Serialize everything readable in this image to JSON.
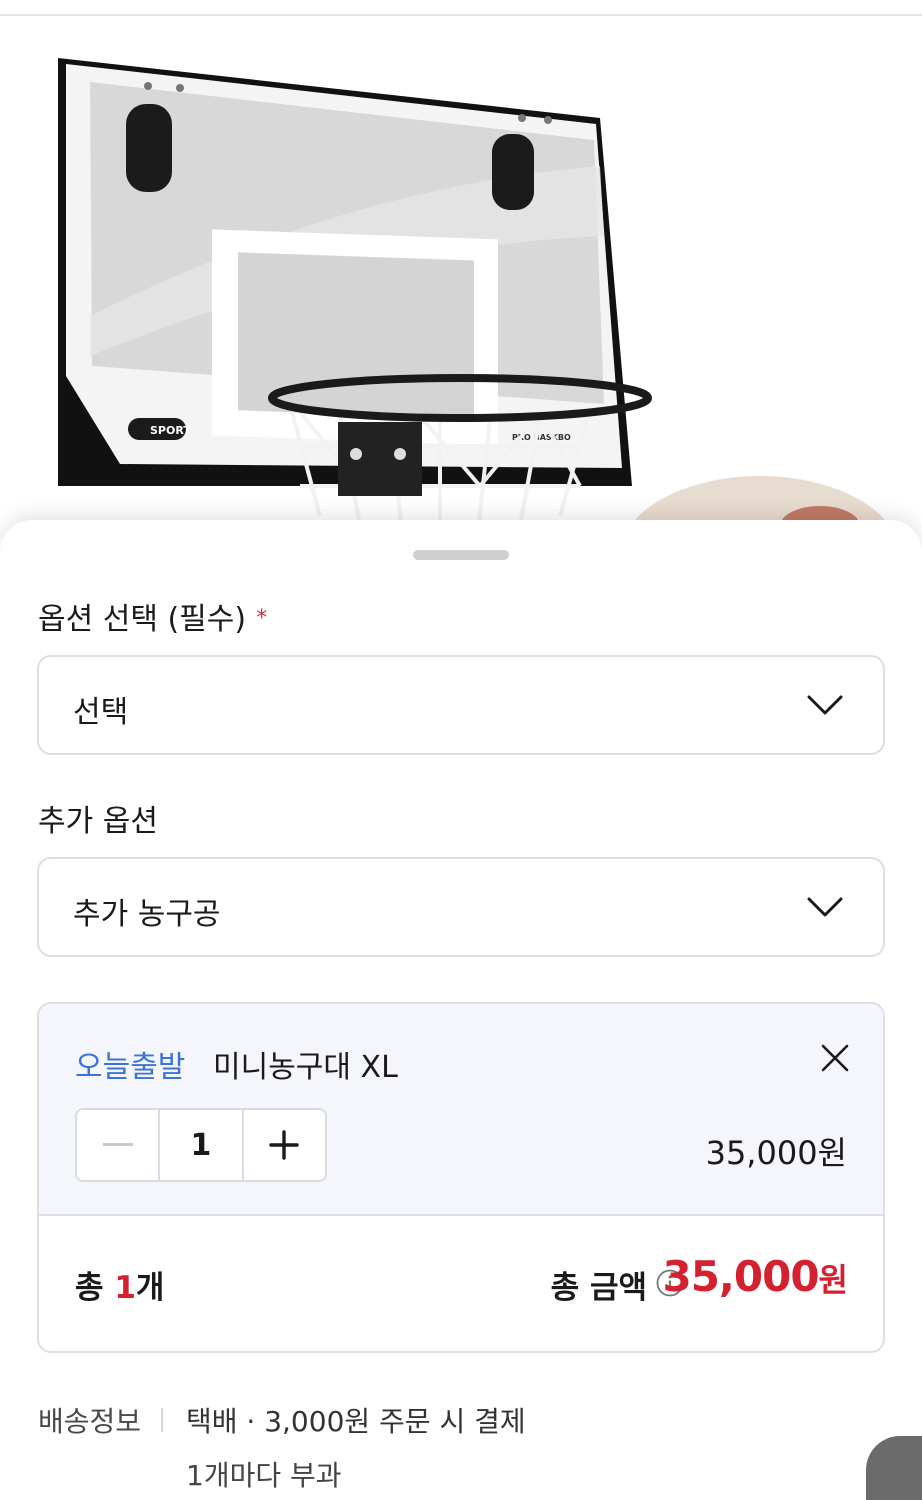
{
  "options": {
    "required_label": "옵션 선택 (필수)",
    "required_marker": "*",
    "required_select_value": "선택",
    "extra_label": "추가 옵션",
    "extra_select_value": "추가 농구공"
  },
  "order_item": {
    "badge": "오늘출발",
    "name": "미니농구대 XL",
    "quantity": "1",
    "price": "35,000원"
  },
  "totals": {
    "count_prefix": "총 ",
    "count_value": "1",
    "count_suffix": "개",
    "amount_label": "총 금액",
    "amount_value": "35,000",
    "amount_unit": "원"
  },
  "shipping": {
    "label": "배송정보",
    "value": "택배 · 3,000원 주문 시 결제",
    "note": "1개마다 부과"
  },
  "product_image": {
    "logo_text": "SPORT",
    "board_text": "PRO BASKBO"
  },
  "colors": {
    "accent_blue": "#3a74d8",
    "price_red": "#d4202f",
    "required_red": "#e0323a"
  },
  "icons": [
    "chevron-down-icon",
    "close-icon",
    "minus-icon",
    "plus-icon",
    "info-icon"
  ]
}
